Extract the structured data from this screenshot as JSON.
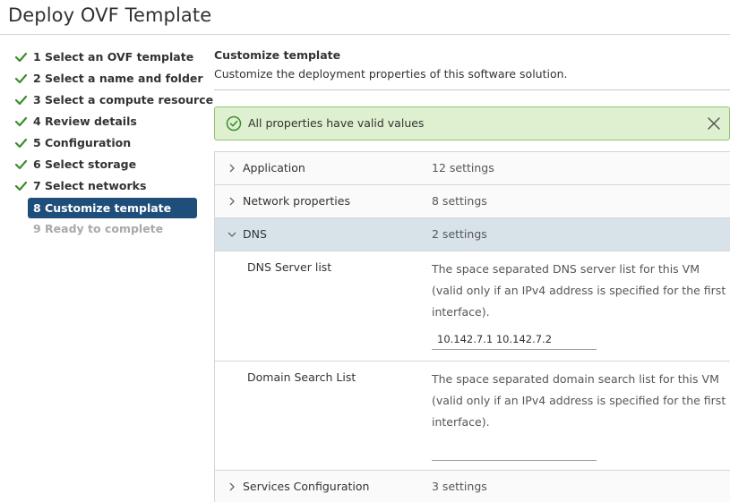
{
  "window": {
    "title": "Deploy OVF Template"
  },
  "steps": [
    {
      "label": "1 Select an OVF template",
      "state": "done"
    },
    {
      "label": "2 Select a name and folder",
      "state": "done"
    },
    {
      "label": "3 Select a compute resource",
      "state": "done"
    },
    {
      "label": "4 Review details",
      "state": "done"
    },
    {
      "label": "5 Configuration",
      "state": "done"
    },
    {
      "label": "6 Select storage",
      "state": "done"
    },
    {
      "label": "7 Select networks",
      "state": "done"
    },
    {
      "label": "8 Customize template",
      "state": "current"
    },
    {
      "label": "9 Ready to complete",
      "state": "pending"
    }
  ],
  "main": {
    "heading": "Customize template",
    "description": "Customize the deployment properties of this software solution."
  },
  "alert": {
    "message": "All properties have valid values",
    "icon": "check-circle-icon"
  },
  "groups": [
    {
      "label": "Application",
      "count": "12 settings",
      "expanded": false
    },
    {
      "label": "Network properties",
      "count": "8 settings",
      "expanded": false
    },
    {
      "label": "DNS",
      "count": "2 settings",
      "expanded": true
    },
    {
      "label": "Services Configuration",
      "count": "3 settings",
      "expanded": false
    }
  ],
  "dns_props": [
    {
      "name": "DNS Server list",
      "description": "The space separated DNS server list for this VM (valid only if an IPv4 address is specified for the first interface).",
      "value": "10.142.7.1 10.142.7.2"
    },
    {
      "name": "Domain Search List",
      "description": "The space separated domain search list for this VM (valid only if an IPv4 address is specified for the first interface).",
      "value": ""
    }
  ],
  "colors": {
    "current_step_bg": "#1f4e7a",
    "check_green": "#3c8d2f",
    "alert_bg": "#dff0d0",
    "alert_border": "#8fc46e",
    "expanded_row_bg": "#d8e3e9"
  }
}
